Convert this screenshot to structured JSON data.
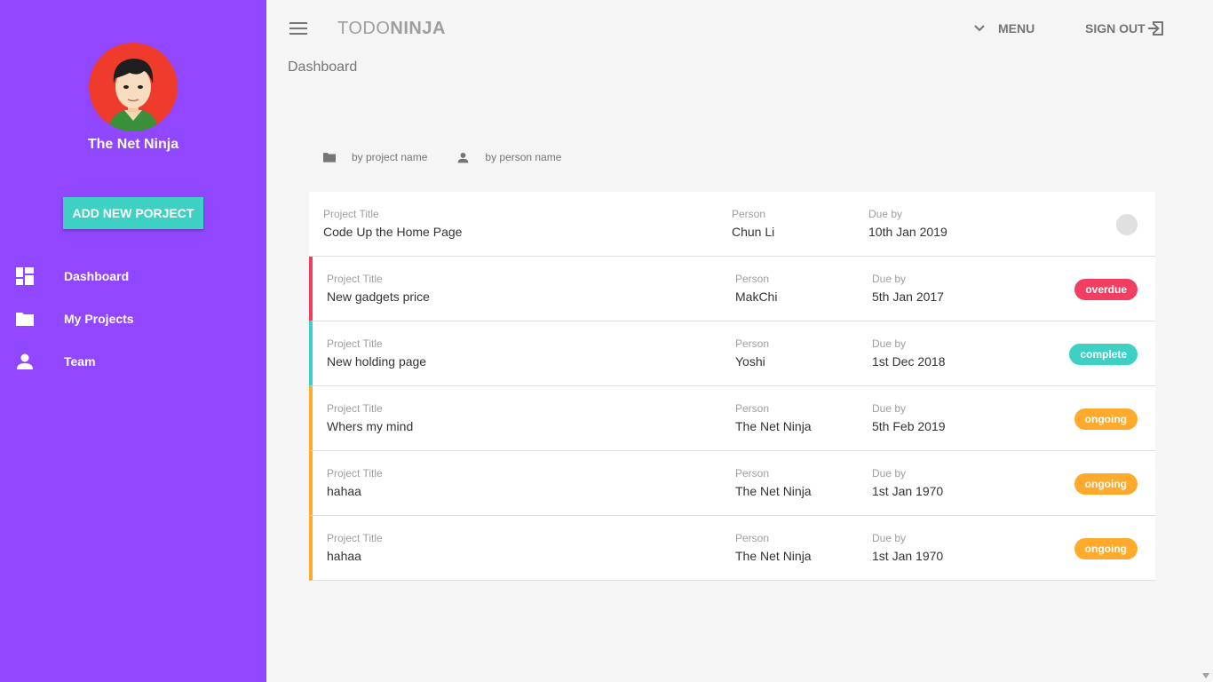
{
  "sidebar": {
    "user_name": "The Net Ninja",
    "add_button": "ADD NEW PORJECT",
    "items": [
      {
        "label": "Dashboard",
        "icon": "dashboard-icon"
      },
      {
        "label": "My Projects",
        "icon": "folder-icon"
      },
      {
        "label": "Team",
        "icon": "person-icon"
      }
    ]
  },
  "toolbar": {
    "brand_light": "TODO",
    "brand_bold": "NINJA",
    "menu_label": "MENU",
    "signout_label": "SIGN OUT"
  },
  "page": {
    "title": "Dashboard"
  },
  "sort": {
    "by_project": "by project name",
    "by_person": "by person name"
  },
  "columns": {
    "title": "Project Title",
    "person": "Person",
    "due": "Due by"
  },
  "projects": [
    {
      "title": "Code Up the Home Page",
      "person": "Chun Li",
      "due": "10th Jan 2019",
      "status": ""
    },
    {
      "title": "New gadgets price",
      "person": "MakChi",
      "due": "5th Jan 2017",
      "status": "overdue"
    },
    {
      "title": "New holding page",
      "person": "Yoshi",
      "due": "1st Dec 2018",
      "status": "complete"
    },
    {
      "title": "Whers my mind",
      "person": "The Net Ninja",
      "due": "5th Feb 2019",
      "status": "ongoing"
    },
    {
      "title": "hahaa",
      "person": "The Net Ninja",
      "due": "1st Jan 1970",
      "status": "ongoing"
    },
    {
      "title": "hahaa",
      "person": "The Net Ninja",
      "due": "1st Jan 1970",
      "status": "ongoing"
    }
  ],
  "colors": {
    "sidebar": "#9147ff",
    "accent": "#3fd0c4",
    "overdue": "#f03f63",
    "complete": "#3fd0c4",
    "ongoing": "#ffaa2c"
  }
}
